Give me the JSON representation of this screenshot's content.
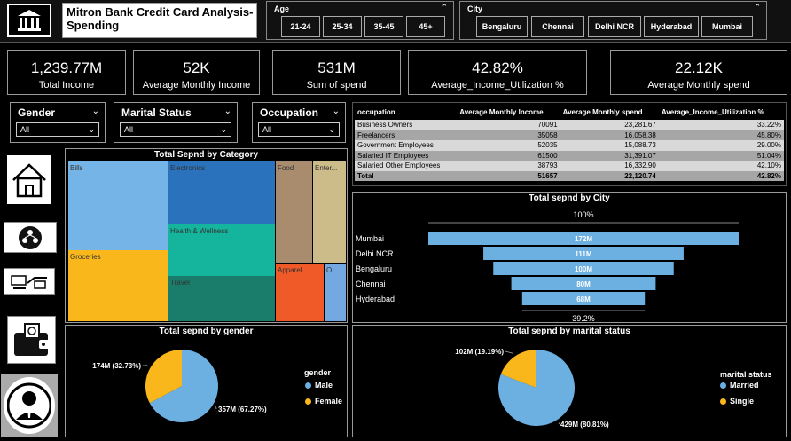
{
  "header": {
    "title": "Mitron Bank Credit Card Analysis- Spending"
  },
  "age": {
    "label": "Age",
    "options": [
      "21-24",
      "25-34",
      "35-45",
      "45+"
    ]
  },
  "city": {
    "label": "City",
    "options": [
      "Bengaluru",
      "Chennai",
      "Delhi NCR",
      "Hyderabad",
      "Mumbai"
    ]
  },
  "kpis": [
    {
      "value": "1,239.77M",
      "label": "Total Income"
    },
    {
      "value": "52K",
      "label": "Average  Monthly Income"
    },
    {
      "value": "531M",
      "label": "Sum of spend"
    },
    {
      "value": "42.82%",
      "label": "Average_Income_Utilization %"
    },
    {
      "value": "22.12K",
      "label": "Average Monthly spend"
    }
  ],
  "filters": {
    "gender": {
      "label": "Gender",
      "value": "All"
    },
    "marital": {
      "label": "Marital Status",
      "value": "All"
    },
    "occupation": {
      "label": "Occupation",
      "value": "All"
    }
  },
  "occupation_table": {
    "headers": [
      "occupation",
      "Average Monthly Income",
      "Average Monthly spend",
      "Average_Income_Utilization %"
    ],
    "rows": [
      [
        "Business Owners",
        "70091",
        "23,281.67",
        "33.22%"
      ],
      [
        "Freelancers",
        "35058",
        "16,058.38",
        "45.80%"
      ],
      [
        "Government Employees",
        "52035",
        "15,088.73",
        "29.00%"
      ],
      [
        "Salaried IT Employees",
        "61500",
        "31,391.07",
        "51.04%"
      ],
      [
        "Salaried Other Employees",
        "38793",
        "16,332.90",
        "42.10%"
      ],
      [
        "Total",
        "51657",
        "22,120.74",
        "42.82%"
      ]
    ]
  },
  "treemap": {
    "title": "Total Sepnd by Category",
    "cells": [
      {
        "label": "Bills",
        "color": "#74b4e6"
      },
      {
        "label": "Groceries",
        "color": "#f9b71b"
      },
      {
        "label": "Electronics",
        "color": "#2a72bc"
      },
      {
        "label": "Health & Wellness",
        "color": "#14b59c"
      },
      {
        "label": "Travel",
        "color": "#1a7d6c"
      },
      {
        "label": "Food",
        "color": "#a98c6e"
      },
      {
        "label": "Enter...",
        "color": "#cbbc8a"
      },
      {
        "label": "Apparel",
        "color": "#f05a28"
      },
      {
        "label": "O...",
        "color": "#74a8e0"
      }
    ]
  },
  "chart_data": [
    {
      "type": "funnel",
      "title": "Total sepnd by City",
      "categories": [
        "Mumbai",
        "Delhi NCR",
        "Bengaluru",
        "Chennai",
        "Hyderabad"
      ],
      "values": [
        172,
        111,
        100,
        80,
        68
      ],
      "labels": [
        "172M",
        "111M",
        "100M",
        "80M",
        "68M"
      ],
      "top_pct": "100%",
      "bottom_pct": "39.2%",
      "color": "#6cb0e2"
    },
    {
      "type": "pie",
      "title": "Total sepnd by gender",
      "legend_title": "gender",
      "categories": [
        "Male",
        "Female"
      ],
      "values": [
        357,
        174
      ],
      "labels": [
        "357M (67.27%)",
        "174M (32.73%)"
      ],
      "colors": [
        "#6cb0e2",
        "#f9b71b"
      ]
    },
    {
      "type": "pie",
      "title": "Total sepnd by marital status",
      "legend_title": "marital status",
      "categories": [
        "Married",
        "Single"
      ],
      "values": [
        429,
        102
      ],
      "labels": [
        "429M (80.81%)",
        "102M (19.19%)"
      ],
      "colors": [
        "#6cb0e2",
        "#f9b71b"
      ]
    }
  ],
  "nav_icons": [
    "home-icon",
    "people-network-icon",
    "money-exchange-icon",
    "wallet-icon",
    "user-icon"
  ]
}
